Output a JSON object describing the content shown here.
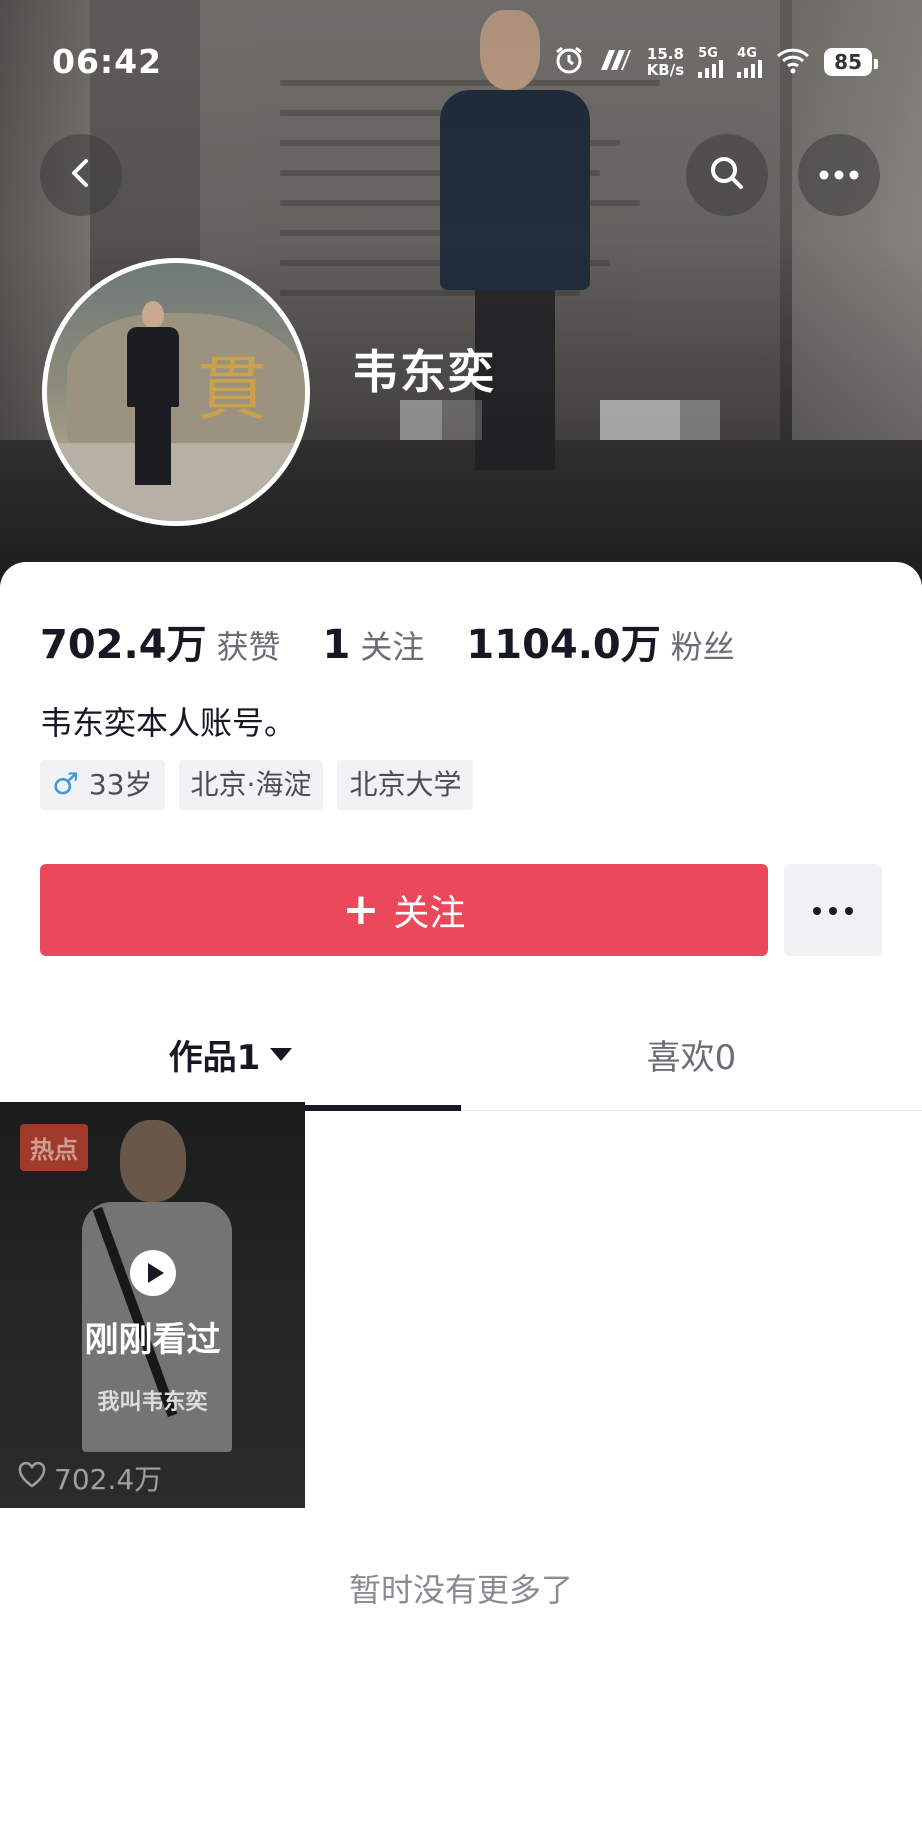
{
  "status_bar": {
    "time": "06:42",
    "net_speed_value": "15.8",
    "net_speed_unit": "KB/s",
    "signal_1": "5G",
    "signal_2": "4G",
    "battery": "85"
  },
  "profile": {
    "username": "韦东奕",
    "bio": "韦东奕本人账号。",
    "tags": {
      "age": "33岁",
      "location": "北京·海淀",
      "school": "北京大学"
    }
  },
  "stats": {
    "likes_value": "702.4万",
    "likes_label": "获赞",
    "following_value": "1",
    "following_label": "关注",
    "followers_value": "1104.0万",
    "followers_label": "粉丝"
  },
  "actions": {
    "follow_plus": "+",
    "follow_label": "关注"
  },
  "tabs": {
    "works_label": "作品1",
    "likes_label": "喜欢0"
  },
  "video": {
    "badge": "热点",
    "seen_label": "刚刚看过",
    "caption": "我叫韦东奕",
    "likes": "702.4万"
  },
  "footer": {
    "no_more": "暂时没有更多了"
  },
  "colors": {
    "follow_button": "#ea485b",
    "male_icon": "#3b9bd6",
    "text_primary": "#161823",
    "text_secondary": "#6b6d74"
  },
  "icons": [
    "back-icon",
    "search-icon",
    "more-icon",
    "alarm-icon",
    "nfc-icon",
    "wifi-icon",
    "male-icon",
    "play-icon",
    "heart-icon",
    "dropdown-triangle-icon"
  ]
}
